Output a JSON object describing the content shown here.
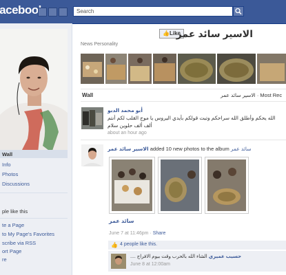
{
  "topbar": {
    "logo": "facebook",
    "search_placeholder": "Search"
  },
  "sidebar": {
    "items": [
      {
        "label": "Wall"
      },
      {
        "label": "Info"
      },
      {
        "label": "Photos"
      },
      {
        "label": "Discussions"
      }
    ],
    "likes_label": "ple like this",
    "actions": [
      {
        "label": "te a Page"
      },
      {
        "label": "to My Page's Favorites"
      },
      {
        "label": "scribe via RSS"
      },
      {
        "label": "ort Page"
      },
      {
        "label": "re"
      }
    ]
  },
  "profile": {
    "name": "الاسير سائد عمر",
    "like_label": "Like",
    "subtitle": "News Personality"
  },
  "wall": {
    "title": "Wall",
    "tabs": "الاسير سائد عمر · Most Rec"
  },
  "posts": [
    {
      "author": "أبو محمد الدبو",
      "text_line1": "الله يحكم وأطلق الله سراحكم وتبت قولكم بأيدي اليروس يا موج القلب لكم أنتم",
      "text_line2": "ألف ألف حلوين سلام",
      "meta": "about an hour ago"
    },
    {
      "author": "الاسير سائد عمر",
      "action": "added 10 new photos to the album",
      "album": "سائد عمر",
      "album_title": "سائد عمر",
      "meta_date": "June 7 at 11:46pm",
      "share": "Share",
      "likes": "4 people like this.",
      "comment_author": "حسيب عميري",
      "comment_text": "الشاء الله بالحرب وقت بيوم الافراج ....",
      "comment_meta": "June 8 at 12:00am"
    }
  ],
  "colors": {
    "brand": "#3b5998",
    "sidebar_bg": "#edeff4"
  }
}
